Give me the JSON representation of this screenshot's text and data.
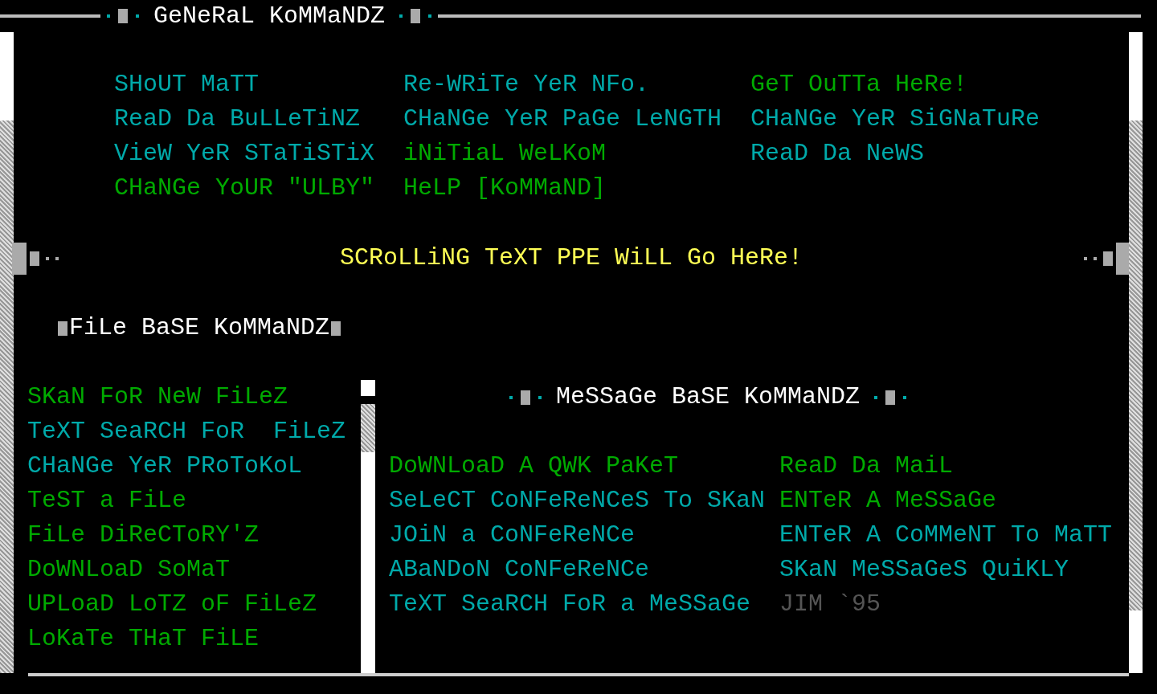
{
  "general": {
    "title": "GeNeRaL KoMMaNDZ",
    "items": [
      {
        "label": "SHoUT MaTT",
        "color": "#00aaaa"
      },
      {
        "label": "Re-WRiTe YeR NFo.",
        "color": "#00aaaa"
      },
      {
        "label": "GeT OuTTa HeRe!",
        "color": "#00aa00"
      },
      {
        "label": "ReaD Da BuLLeTiNZ",
        "color": "#00aaaa"
      },
      {
        "label": "CHaNGe YeR PaGe LeNGTH",
        "color": "#00aaaa"
      },
      {
        "label": "CHaNGe YeR SiGNaTuRe",
        "color": "#00aaaa"
      },
      {
        "label": "VieW YeR STaTiSTiX",
        "color": "#00aaaa"
      },
      {
        "label": "iNiTiaL WeLKoM",
        "color": "#00aa00"
      },
      {
        "label": "ReaD Da NeWS",
        "color": "#00aaaa"
      },
      {
        "label": "CHaNGe YoUR \"ULBY\"",
        "color": "#00aa00"
      },
      {
        "label": "HeLP [KoMMaND]",
        "color": "#00aa00"
      }
    ]
  },
  "scroller": {
    "text": "SCRoLLiNG TeXT PPE WiLL Go HeRe!"
  },
  "file_base": {
    "title": "FiLe BaSE KoMMaNDZ",
    "items": [
      {
        "label": "SKaN FoR NeW FiLeZ",
        "color": "#00aa00"
      },
      {
        "label": "TeXT SeaRCH FoR  FiLeZ",
        "color": "#00aaaa"
      },
      {
        "label": "CHaNGe YeR PRoToKoL",
        "color": "#00aaaa"
      },
      {
        "label": "TeST a FiLe",
        "color": "#00aa00"
      },
      {
        "label": "FiLe DiReCToRY'Z",
        "color": "#00aa00"
      },
      {
        "label": "DoWNLoaD SoMaT",
        "color": "#00aa00"
      },
      {
        "label": "UPLoaD LoTZ oF FiLeZ",
        "color": "#00aa00"
      },
      {
        "label": "LoKaTe THaT FiLE",
        "color": "#00aa00"
      }
    ]
  },
  "message_base": {
    "title": "MeSSaGe BaSE KoMMaNDZ",
    "items": [
      {
        "label": "DoWNLoaD A QWK PaKeT",
        "color": "#00aa00"
      },
      {
        "label": "ReaD Da MaiL",
        "color": "#00aa00"
      },
      {
        "label": "SeLeCT CoNFeReNCeS To SKaN",
        "color": "#00aaaa"
      },
      {
        "label": "ENTeR A MeSSaGe",
        "color": "#00aa00"
      },
      {
        "label": "JOiN a CoNFeReNCe",
        "color": "#00aaaa"
      },
      {
        "label": "ENTeR A CoMMeNT To MaTT",
        "color": "#00aaaa"
      },
      {
        "label": "ABaNDoN CoNFeReNCe",
        "color": "#00aaaa"
      },
      {
        "label": "SKaN MeSSaGeS QuiKLY",
        "color": "#00aaaa"
      },
      {
        "label": "TeXT SeaRCH FoR a MeSSaGe",
        "color": "#00aaaa"
      },
      {
        "label": "JIM `95",
        "color": "#555555"
      }
    ]
  }
}
